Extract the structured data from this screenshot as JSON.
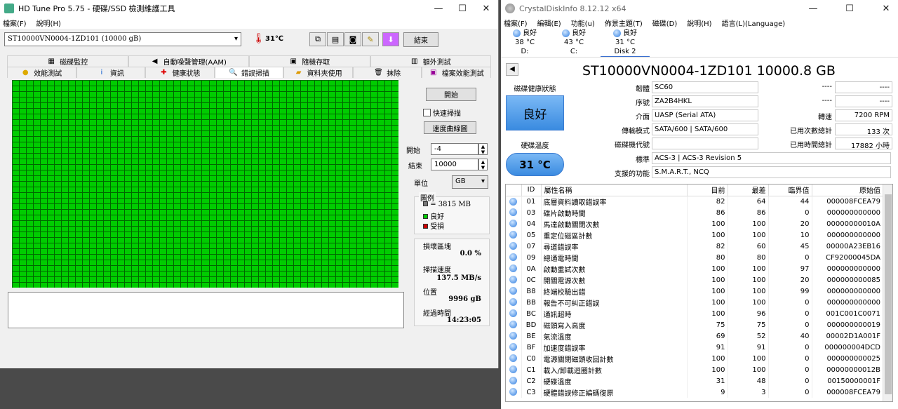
{
  "hdtune": {
    "title": "HD Tune Pro 5.75 - 硬碟/SSD 檢測維護工具",
    "menu": [
      "檔案(F)",
      "說明(H)"
    ],
    "drive": "ST10000VN0004-1ZD101 (10000 gB)",
    "temp": "31℃",
    "exit_label": "結束",
    "tabs_top": [
      "磁碟監控",
      "自動噪聲管理(AAM)",
      "隨機存取",
      "額外測試"
    ],
    "tabs_bottom": [
      "效能測試",
      "資訊",
      "健康狀態",
      "錯誤掃描",
      "資料夾使用",
      "抹除",
      "檔案效能測試"
    ],
    "start_button": "開始",
    "quick_scan": "快速掃描",
    "speed_map": "速度曲線圖",
    "start_label": "開始",
    "start_value": "-4",
    "end_label": "結束",
    "end_value": "10000",
    "unit_label": "單位",
    "unit_value": "GB",
    "legend_title": "圖例",
    "legend": [
      "= 3815 MB",
      "良好",
      "受損"
    ],
    "damaged_label": "損壞區塊",
    "damaged_value": "0.0 %",
    "speed_label": "掃描速度",
    "speed_value": "137.5 MB/s",
    "pos_label": "位置",
    "pos_value": "9996 gB",
    "elapsed_label": "經過時間",
    "elapsed_value": "14:23:05"
  },
  "cdi": {
    "title": "CrystalDiskInfo 8.12.12 x64",
    "menu": [
      "檔案(F)",
      "編輯(E)",
      "功能(u)",
      "佈景主題(T)",
      "磁碟(D)",
      "說明(H)",
      "語言(L)(Language)"
    ],
    "drives": [
      {
        "status": "良好",
        "temp": "38 °C",
        "name": "D:"
      },
      {
        "status": "良好",
        "temp": "43 °C",
        "name": "C:"
      },
      {
        "status": "良好",
        "temp": "31 °C",
        "name": "Disk 2"
      }
    ],
    "model": "ST10000VN0004-1ZD101 10000.8 GB",
    "health_label": "磁碟健康狀態",
    "health_value": "良好",
    "temp_label": "硬碟溫度",
    "temp_value": "31 °C",
    "firmware_label": "韌體",
    "firmware": "SC60",
    "serial_label": "序號",
    "serial": "ZA2B4HKL",
    "interface_label": "介面",
    "interface": "UASP (Serial ATA)",
    "transfer_label": "傳輸模式",
    "transfer": "SATA/600 | SATA/600",
    "letter_label": "磁碟機代號",
    "letter": "",
    "standard_label": "標準",
    "standard": "ACS-3 | ACS-3 Revision 5",
    "features_label": "支援的功能",
    "features": "S.M.A.R.T., NCQ",
    "r1_label": "----",
    "r1": "----",
    "r2_label": "----",
    "r2": "----",
    "rpm_label": "轉速",
    "rpm": "7200 RPM",
    "poc_label": "已用次數總計",
    "poc": "133 次",
    "poh_label": "已用時間總計",
    "poh": "17882 小時",
    "columns": [
      "ID",
      "屬性名稱",
      "目前",
      "最差",
      "臨界值",
      "原始值"
    ],
    "rows": [
      [
        "01",
        "底層資料讀取錯誤率",
        "82",
        "64",
        "44",
        "000008FCEA79"
      ],
      [
        "03",
        "碟片啟動時間",
        "86",
        "86",
        "0",
        "000000000000"
      ],
      [
        "04",
        "馬達啟動關閉次數",
        "100",
        "100",
        "20",
        "00000000010A"
      ],
      [
        "05",
        "重定位磁區計數",
        "100",
        "100",
        "10",
        "000000000000"
      ],
      [
        "07",
        "尋道錯誤率",
        "82",
        "60",
        "45",
        "00000A23EB16"
      ],
      [
        "09",
        "總通電時間",
        "80",
        "80",
        "0",
        "CF92000045DA"
      ],
      [
        "0A",
        "啟動重試次數",
        "100",
        "100",
        "97",
        "000000000000"
      ],
      [
        "0C",
        "開關電源次數",
        "100",
        "100",
        "20",
        "000000000085"
      ],
      [
        "B8",
        "終端校驗出錯",
        "100",
        "100",
        "99",
        "000000000000"
      ],
      [
        "BB",
        "報告不可糾正錯誤",
        "100",
        "100",
        "0",
        "000000000000"
      ],
      [
        "BC",
        "通訊超時",
        "100",
        "96",
        "0",
        "001C001C0071"
      ],
      [
        "BD",
        "磁頭寫入高度",
        "75",
        "75",
        "0",
        "000000000019"
      ],
      [
        "BE",
        "氣流溫度",
        "69",
        "52",
        "40",
        "00002D1A001F"
      ],
      [
        "BF",
        "加速度錯誤率",
        "91",
        "91",
        "0",
        "000000004DCD"
      ],
      [
        "C0",
        "電源關閉磁頭收回計數",
        "100",
        "100",
        "0",
        "000000000025"
      ],
      [
        "C1",
        "載入/卸載迴圈計數",
        "100",
        "100",
        "0",
        "00000000012B"
      ],
      [
        "C2",
        "硬碟溫度",
        "31",
        "48",
        "0",
        "00150000001F"
      ],
      [
        "C3",
        "硬體錯誤修正編碼復原",
        "9",
        "3",
        "0",
        "000008FCEA79"
      ]
    ],
    "colors": {
      "good": "#3a8be0",
      "grid": "#00cc00"
    }
  }
}
